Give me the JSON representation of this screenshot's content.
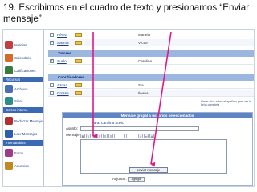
{
  "caption": {
    "line1": "19. Escribimos en el cuadro de texto y presionamos “Enviar",
    "line2": "mensaje”"
  },
  "sidebar": {
    "items": [
      {
        "label": "Noticias",
        "icon": "newspaper-icon",
        "color": "#c04040"
      },
      {
        "label": "Calendario",
        "icon": "calendar-icon",
        "color": "#d66a28"
      },
      {
        "label": "Calificaciones",
        "icon": "grades-icon",
        "color": "#3a7a3a"
      }
    ],
    "section1": "Recursos",
    "items2": [
      {
        "label": "Archivos",
        "icon": "files-icon",
        "color": "#4a6fb0"
      },
      {
        "label": "Sitios",
        "icon": "globe-icon",
        "color": "#2e8b8b"
      }
    ],
    "section2": "Correo interno",
    "items3": [
      {
        "label": "Redactar Mensaje",
        "icon": "compose-icon",
        "color": "#b03030"
      },
      {
        "label": "Leer Mensajes",
        "icon": "read-mail-icon",
        "color": "#2f5fa8"
      }
    ],
    "section3": "Intercambios",
    "items4": [
      {
        "label": "Foros",
        "icon": "forum-icon",
        "color": "#a03a8a"
      },
      {
        "label": "Anuncios",
        "icon": "announce-icon",
        "color": "#c08a20"
      }
    ]
  },
  "list": {
    "rows_top": [
      {
        "name": "Pérez",
        "who": "Mariela",
        "checked": false
      },
      {
        "name": "Saoma",
        "who": "Víctor",
        "checked": true
      }
    ],
    "group1": "Tutores",
    "rows_mid": [
      {
        "name": "Suelo",
        "who": "Carolina",
        "checked": true
      }
    ],
    "group2": "Coordinadores",
    "rows_bot": [
      {
        "name": "Aznar",
        "who": "Sia",
        "checked": false
      },
      {
        "name": "Crosse",
        "who": "Ileana",
        "checked": false
      }
    ],
    "note": "Hacer click sobre el apellido para ver la ficha completa"
  },
  "form": {
    "title": "Mensaje grupal a usuarios seleccionados",
    "to": "Para: Carolina Suelo",
    "asunto_label": "Asunto:",
    "mensaje_label": "Mensaje:",
    "adjuntar_label": "Adjuntar:",
    "adjuntar_button": "Agregar",
    "send_button": "enviar mensaje"
  },
  "colors": {
    "arrow": "#e0188a",
    "header": "#5d84c4",
    "sidebar_head": "#3c6ab2"
  }
}
